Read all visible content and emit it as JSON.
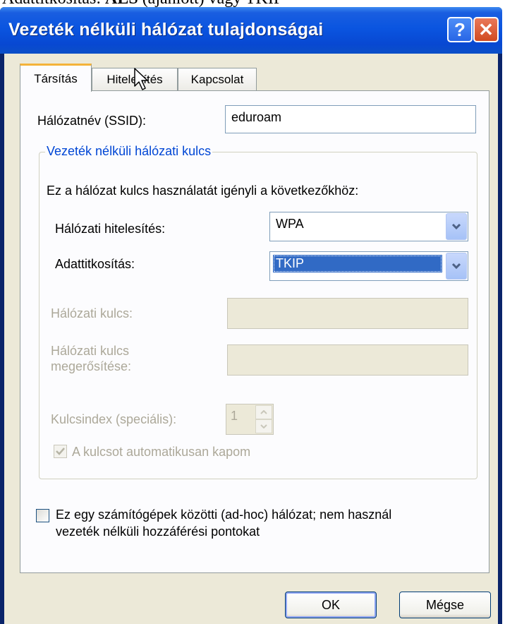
{
  "caption": {
    "prefix": "Adattitkosítás: ",
    "bold": "AES",
    "suffix": " (ajánlott) vagy TKIP"
  },
  "window": {
    "title": "Vezeték nélküli hálózat tulajdonságai",
    "help_glyph": "?",
    "close_glyph": "✕"
  },
  "tabs": [
    {
      "label": "Társítás",
      "active": true
    },
    {
      "label": "Hitelesítés",
      "active": false
    },
    {
      "label": "Kapcsolat",
      "active": false
    }
  ],
  "ssid": {
    "label": "Hálózatnév (SSID):",
    "value": "eduroam"
  },
  "key_group": {
    "legend": "Vezeték nélküli hálózati kulcs",
    "description": "Ez a hálózat kulcs használatát igényli a következőkhöz:",
    "auth": {
      "label": "Hálózati hitelesítés:",
      "value": "WPA"
    },
    "encryption": {
      "label": "Adattitkosítás:",
      "value": "TKIP"
    },
    "network_key": {
      "label": "Hálózati kulcs:",
      "value": ""
    },
    "confirm_key": {
      "label_line1": "Hálózati kulcs",
      "label_line2": "megerősítése:",
      "value": ""
    },
    "key_index": {
      "label": "Kulcsindex (speciális):",
      "value": "1"
    },
    "auto_key": {
      "label": "A kulcsot automatikusan kapom",
      "checked": true
    }
  },
  "adhoc": {
    "line1": "Ez egy számítógépek közötti (ad-hoc) hálózat; nem használ",
    "line2": "vezeték nélküli hozzáférési pontokat",
    "checked": false
  },
  "buttons": {
    "ok": "OK",
    "cancel": "Mégse"
  },
  "colors": {
    "titlebar": "#0a55e0",
    "dialog_bg": "#ece9d8",
    "group_legend": "#0046d5",
    "selection": "#316ac5",
    "disabled_text": "#aca899"
  }
}
